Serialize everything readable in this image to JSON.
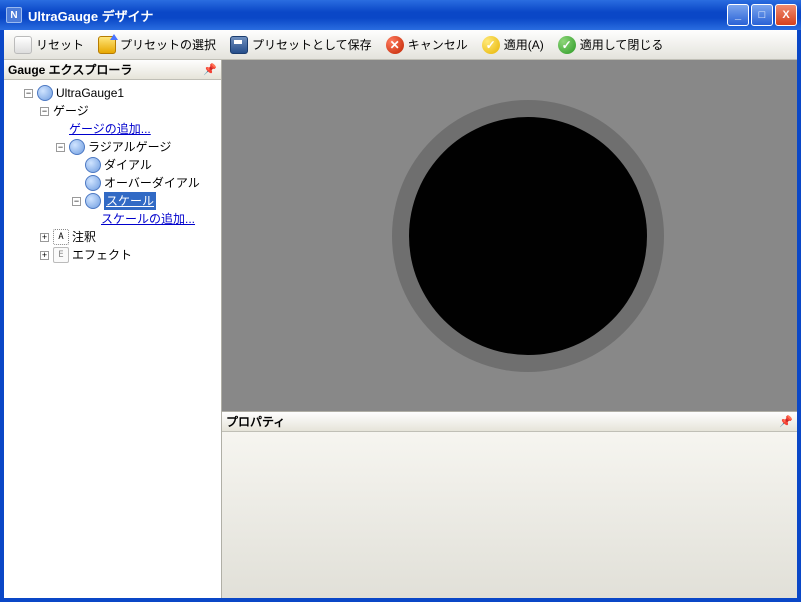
{
  "window": {
    "title": "UltraGauge デザイナ",
    "app_icon_text": "N"
  },
  "toolbar": {
    "reset": "リセット",
    "open_preset": "プリセットの選択",
    "save_preset": "プリセットとして保存",
    "cancel": "キャンセル",
    "apply": "適用(A)",
    "apply_close": "適用して閉じる"
  },
  "explorer": {
    "title": "Gauge エクスプローラ"
  },
  "tree": {
    "root": "UltraGauge1",
    "gauges": "ゲージ",
    "add_gauge": "ゲージの追加...",
    "radial": "ラジアルゲージ",
    "dial": "ダイアル",
    "overdial": "オーバーダイアル",
    "scale": "スケール",
    "add_scale": "スケールの追加...",
    "annotations": "注釈",
    "effects": "エフェクト"
  },
  "properties": {
    "title": "プロパティ"
  },
  "colors": {
    "preview_bg": "#888888",
    "gauge_rim": "#6f6f6f",
    "gauge_face": "#010101"
  }
}
